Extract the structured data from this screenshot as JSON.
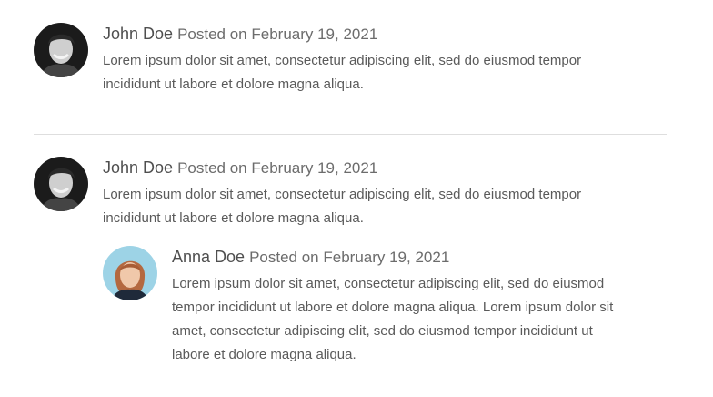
{
  "comments": [
    {
      "author": "John Doe",
      "posted": "Posted on February 19, 2021",
      "text_lines": [
        "Lorem ipsum dolor sit amet, consectetur adipiscing elit, sed do eiusmod tempor",
        "incididunt ut labore et dolore magna aliqua."
      ]
    },
    {
      "author": "John Doe",
      "posted": "Posted on February 19, 2021",
      "text_lines": [
        "Lorem ipsum dolor sit amet, consectetur adipiscing elit, sed do eiusmod tempor",
        "incididunt ut labore et dolore magna aliqua."
      ],
      "reply": {
        "author": "Anna Doe",
        "posted": "Posted on February 19, 2021",
        "text_lines": [
          "Lorem ipsum dolor sit amet, consectetur adipiscing elit, sed do eiusmod",
          "tempor incididunt ut labore et dolore magna aliqua. Lorem ipsum dolor sit",
          "amet, consectetur adipiscing elit, sed do eiusmod tempor incididunt ut",
          "labore et dolore magna aliqua."
        ]
      }
    }
  ],
  "colors": {
    "text": "#4f4f4f",
    "meta": "#6c6c6c",
    "divider": "#dedede"
  },
  "icons": {
    "john_avatar": "avatar-john",
    "anna_avatar": "avatar-anna"
  }
}
